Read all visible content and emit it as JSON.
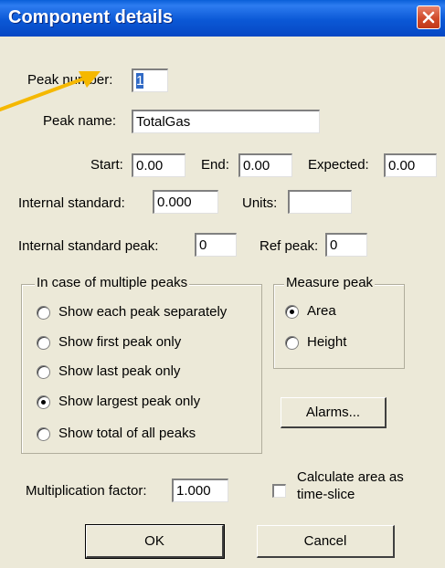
{
  "window": {
    "title": "Component details",
    "close_icon": "close-icon",
    "titlebar_color": "#0a5fd8"
  },
  "fields": {
    "peak_number": {
      "label": "Peak number:",
      "value": "1"
    },
    "peak_name": {
      "label": "Peak name:",
      "value": "TotalGas"
    },
    "start": {
      "label": "Start:",
      "value": "0.00"
    },
    "end": {
      "label": "End:",
      "value": "0.00"
    },
    "expected": {
      "label": "Expected:",
      "value": "0.00"
    },
    "internal_standard": {
      "label": "Internal standard:",
      "value": "0.000"
    },
    "units": {
      "label": "Units:",
      "value": ""
    },
    "internal_standard_peak": {
      "label": "Internal standard peak:",
      "value": "0"
    },
    "ref_peak": {
      "label": "Ref peak:",
      "value": "0"
    },
    "multiplication_factor": {
      "label": "Multiplication factor:",
      "value": "1.000"
    }
  },
  "multiple_peaks": {
    "title": "In case of multiple peaks",
    "options": [
      {
        "label": "Show each peak separately",
        "selected": false
      },
      {
        "label": "Show first peak only",
        "selected": false
      },
      {
        "label": "Show last peak only",
        "selected": false
      },
      {
        "label": "Show largest peak only",
        "selected": true
      },
      {
        "label": "Show total of all peaks",
        "selected": false
      }
    ]
  },
  "measure_peak": {
    "title": "Measure peak",
    "options": [
      {
        "label": "Area",
        "selected": true
      },
      {
        "label": "Height",
        "selected": false
      }
    ]
  },
  "buttons": {
    "alarms": "Alarms...",
    "ok": "OK",
    "cancel": "Cancel"
  },
  "checkbox": {
    "label_line1": "Calculate area as",
    "label_line2": "time-slice",
    "checked": false
  },
  "annotation": {
    "arrow_color": "#f5b800",
    "icon": "arrow-pointer-icon"
  }
}
